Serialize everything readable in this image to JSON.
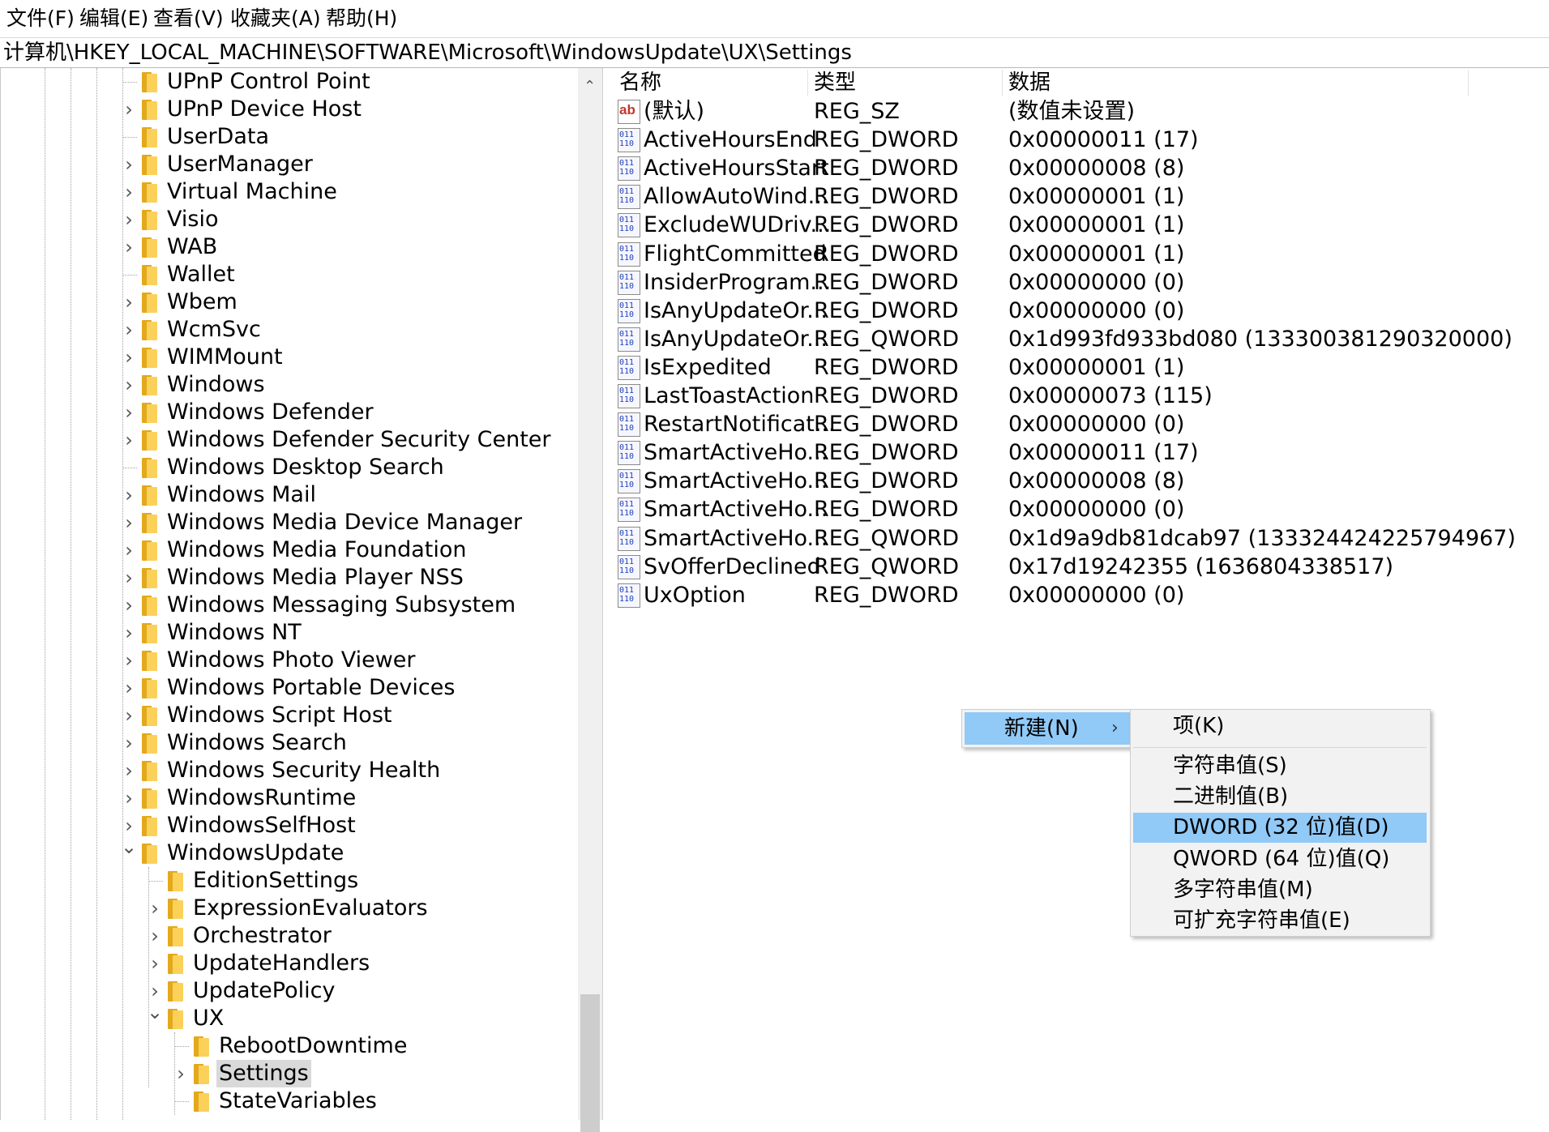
{
  "menubar": {
    "items": [
      "文件(F)",
      "编辑(E)",
      "查看(V)",
      "收藏夹(A)",
      "帮助(H)"
    ]
  },
  "address": "计算机\\HKEY_LOCAL_MACHINE\\SOFTWARE\\Microsoft\\WindowsUpdate\\UX\\Settings",
  "tree": {
    "items": [
      {
        "label": "UPnP Control Point",
        "toggle": ""
      },
      {
        "label": "UPnP Device Host",
        "toggle": "›"
      },
      {
        "label": "UserData",
        "toggle": ""
      },
      {
        "label": "UserManager",
        "toggle": "›"
      },
      {
        "label": "Virtual Machine",
        "toggle": "›"
      },
      {
        "label": "Visio",
        "toggle": "›"
      },
      {
        "label": "WAB",
        "toggle": "›"
      },
      {
        "label": "Wallet",
        "toggle": ""
      },
      {
        "label": "Wbem",
        "toggle": "›"
      },
      {
        "label": "WcmSvc",
        "toggle": "›"
      },
      {
        "label": "WIMMount",
        "toggle": "›"
      },
      {
        "label": "Windows",
        "toggle": "›"
      },
      {
        "label": "Windows Defender",
        "toggle": "›"
      },
      {
        "label": "Windows Defender Security Center",
        "toggle": "›"
      },
      {
        "label": "Windows Desktop Search",
        "toggle": ""
      },
      {
        "label": "Windows Mail",
        "toggle": "›"
      },
      {
        "label": "Windows Media Device Manager",
        "toggle": "›"
      },
      {
        "label": "Windows Media Foundation",
        "toggle": "›"
      },
      {
        "label": "Windows Media Player NSS",
        "toggle": "›"
      },
      {
        "label": "Windows Messaging Subsystem",
        "toggle": "›"
      },
      {
        "label": "Windows NT",
        "toggle": "›"
      },
      {
        "label": "Windows Photo Viewer",
        "toggle": "›"
      },
      {
        "label": "Windows Portable Devices",
        "toggle": "›"
      },
      {
        "label": "Windows Script Host",
        "toggle": "›"
      },
      {
        "label": "Windows Search",
        "toggle": "›"
      },
      {
        "label": "Windows Security Health",
        "toggle": "›"
      },
      {
        "label": "WindowsRuntime",
        "toggle": "›"
      },
      {
        "label": "WindowsSelfHost",
        "toggle": "›"
      },
      {
        "label": "WindowsUpdate",
        "toggle": "⌄"
      },
      {
        "label": "EditionSettings",
        "toggle": ""
      },
      {
        "label": "ExpressionEvaluators",
        "toggle": "›"
      },
      {
        "label": "Orchestrator",
        "toggle": "›"
      },
      {
        "label": "UpdateHandlers",
        "toggle": "›"
      },
      {
        "label": "UpdatePolicy",
        "toggle": "›"
      },
      {
        "label": "UX",
        "toggle": "⌄"
      },
      {
        "label": "RebootDowntime",
        "toggle": ""
      },
      {
        "label": "Settings",
        "toggle": "›"
      },
      {
        "label": "StateVariables",
        "toggle": ""
      }
    ]
  },
  "list": {
    "headers": {
      "name": "名称",
      "type": "类型",
      "data": "数据"
    },
    "bin_icon_text": "011\n110",
    "ab_icon_text": "ab",
    "rows": [
      {
        "name": "(默认)",
        "type": "REG_SZ",
        "data": "(数值未设置)",
        "icon": "string-value-icon"
      },
      {
        "name": "ActiveHoursEnd",
        "type": "REG_DWORD",
        "data": "0x00000011 (17)",
        "icon": "binary-value-icon"
      },
      {
        "name": "ActiveHoursStart",
        "type": "REG_DWORD",
        "data": "0x00000008 (8)",
        "icon": "binary-value-icon"
      },
      {
        "name": "AllowAutoWind...",
        "type": "REG_DWORD",
        "data": "0x00000001 (1)",
        "icon": "binary-value-icon"
      },
      {
        "name": "ExcludeWUDriv...",
        "type": "REG_DWORD",
        "data": "0x00000001 (1)",
        "icon": "binary-value-icon"
      },
      {
        "name": "FlightCommitted",
        "type": "REG_DWORD",
        "data": "0x00000001 (1)",
        "icon": "binary-value-icon"
      },
      {
        "name": "InsiderProgram...",
        "type": "REG_DWORD",
        "data": "0x00000000 (0)",
        "icon": "binary-value-icon"
      },
      {
        "name": "IsAnyUpdateOr...",
        "type": "REG_DWORD",
        "data": "0x00000000 (0)",
        "icon": "binary-value-icon"
      },
      {
        "name": "IsAnyUpdateOr...",
        "type": "REG_QWORD",
        "data": "0x1d993fd933bd080 (133300381290320000)",
        "icon": "binary-value-icon"
      },
      {
        "name": "IsExpedited",
        "type": "REG_DWORD",
        "data": "0x00000001 (1)",
        "icon": "binary-value-icon"
      },
      {
        "name": "LastToastAction",
        "type": "REG_DWORD",
        "data": "0x00000073 (115)",
        "icon": "binary-value-icon"
      },
      {
        "name": "RestartNotificat...",
        "type": "REG_DWORD",
        "data": "0x00000000 (0)",
        "icon": "binary-value-icon"
      },
      {
        "name": "SmartActiveHo...",
        "type": "REG_DWORD",
        "data": "0x00000011 (17)",
        "icon": "binary-value-icon"
      },
      {
        "name": "SmartActiveHo...",
        "type": "REG_DWORD",
        "data": "0x00000008 (8)",
        "icon": "binary-value-icon"
      },
      {
        "name": "SmartActiveHo...",
        "type": "REG_DWORD",
        "data": "0x00000000 (0)",
        "icon": "binary-value-icon"
      },
      {
        "name": "SmartActiveHo...",
        "type": "REG_QWORD",
        "data": "0x1d9a9db81dcab97 (133324424225794967)",
        "icon": "binary-value-icon"
      },
      {
        "name": "SvOfferDeclined",
        "type": "REG_QWORD",
        "data": "0x17d19242355 (1636804338517)",
        "icon": "binary-value-icon"
      },
      {
        "name": "UxOption",
        "type": "REG_DWORD",
        "data": "0x00000000 (0)",
        "icon": "binary-value-icon"
      }
    ]
  },
  "context_menu": {
    "new_label": "新建(N)",
    "arrow": "›",
    "submenu": [
      {
        "label": "项(K)",
        "active": false
      },
      {
        "label": "字符串值(S)",
        "active": false
      },
      {
        "label": "二进制值(B)",
        "active": false
      },
      {
        "label": "DWORD (32 位)值(D)",
        "active": true
      },
      {
        "label": "QWORD (64 位)值(Q)",
        "active": false
      },
      {
        "label": "多字符串值(M)",
        "active": false
      },
      {
        "label": "可扩充字符串值(E)",
        "active": false
      }
    ]
  },
  "colors": {
    "folder_back": "#e3a91c",
    "folder_front": "#fbd15a",
    "menu_highlight": "#91c9f7",
    "tree_selection": "#d9d9d9"
  }
}
